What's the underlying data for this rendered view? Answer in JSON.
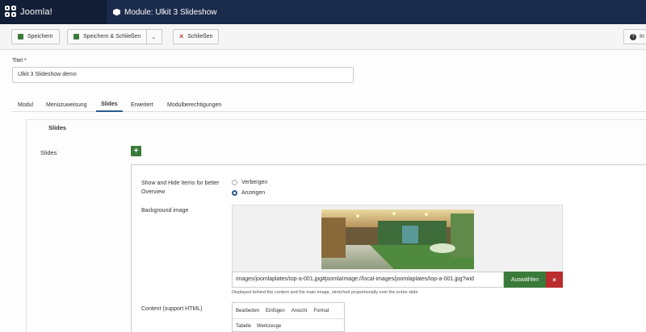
{
  "brand": {
    "name": "Joomla!"
  },
  "header": {
    "title": "Module: Ulkit 3 Slideshow"
  },
  "toolbar": {
    "save_label": "Speichern",
    "save_close_label": "Speichern & Schließen",
    "close_label": "Schließen",
    "help_label": "In"
  },
  "form": {
    "title_label": "Titel *",
    "title_value": "Ulkit 3 Slideshow demo"
  },
  "tabs": [
    {
      "label": "Modul"
    },
    {
      "label": "Menüzuweisung"
    },
    {
      "label": "Slides",
      "active": true
    },
    {
      "label": "Erweitert"
    },
    {
      "label": "Modulberechtigungen"
    }
  ],
  "slides": {
    "legend": "Slides",
    "field_label": "Slides",
    "add_label": "+",
    "show_hide_label": "Show and Hide Items for better Overview",
    "radio_hide": "Verbergen",
    "radio_show": "Anzeigen",
    "radio_selected": "Anzeigen",
    "bg_label": "Background image",
    "bg_path": "images/joomlaplates/top-a-001.jpg#joomlaImage://local-images/joomlaplates/top-a-001.jpg?wid",
    "select_label": "Auswählen",
    "clear_label": "×",
    "bg_hint": "Displayed behind the content and the main image, stretched proportionally over the entire slide",
    "content_label": "Content (support HTML)",
    "editor_menu": [
      "Bearbeiten",
      "Einfügen",
      "Ansicht",
      "Format"
    ],
    "editor_tools": [
      "Tabelle",
      "Werkzeuge"
    ]
  },
  "colors": {
    "topbar": "#1a2a4a",
    "primary_green": "#3a7a3a",
    "danger_red": "#bb2c2c",
    "tab_accent": "#2b5b8e"
  }
}
